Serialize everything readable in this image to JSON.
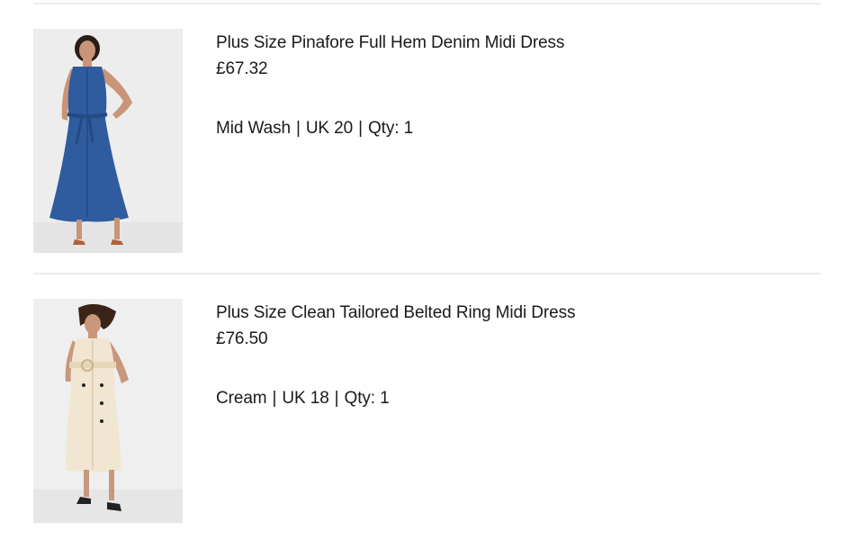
{
  "bag": {
    "items": [
      {
        "name": "Plus Size Pinafore Full Hem Denim Midi Dress",
        "price": "£67.32",
        "color": "Mid Wash",
        "size": "UK 20",
        "qty": "Qty: 1",
        "image": "product-photo-denim-dress",
        "dress_color": "#2f5c9e"
      },
      {
        "name": "Plus Size Clean Tailored Belted Ring Midi Dress",
        "price": "£76.50",
        "color": "Cream",
        "size": "UK 18",
        "qty": "Qty: 1",
        "image": "product-photo-cream-dress",
        "dress_color": "#f1e6d2"
      }
    ],
    "separator": "|"
  }
}
